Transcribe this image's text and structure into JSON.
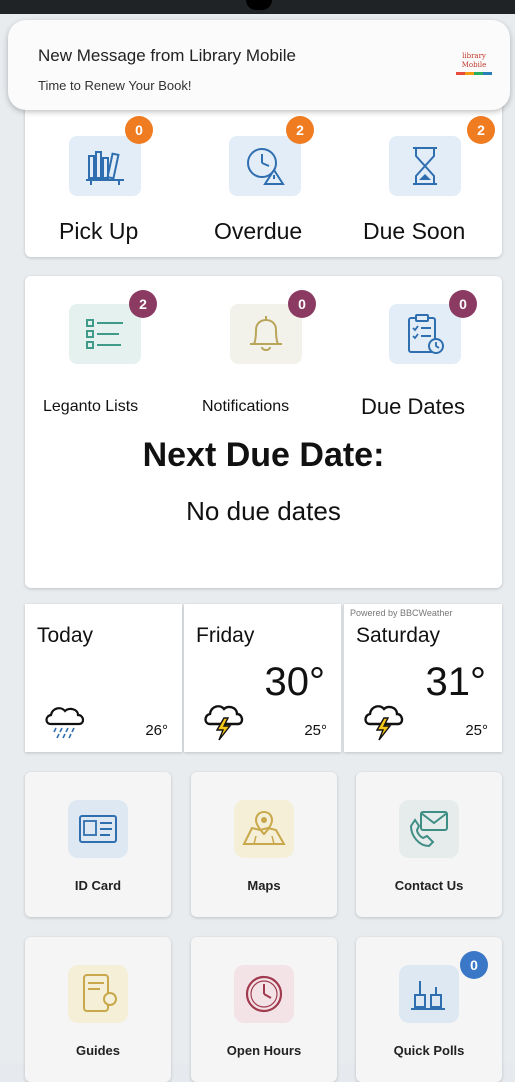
{
  "notification": {
    "title": "New Message from  Library Mobile",
    "body": "Time to Renew Your Book!",
    "logo_line1": "library",
    "logo_line2": "Mobile"
  },
  "loans": [
    {
      "label": "Pick Up",
      "count": "0",
      "icon": "books-on-shelf-icon"
    },
    {
      "label": "Overdue",
      "count": "2",
      "icon": "clock-warning-icon"
    },
    {
      "label": "Due Soon",
      "count": "2",
      "icon": "hourglass-icon"
    }
  ],
  "account": [
    {
      "label": "Leganto Lists",
      "count": "2",
      "icon": "list-icon"
    },
    {
      "label": "Notifications",
      "count": "0",
      "icon": "bell-icon"
    },
    {
      "label": "Due Dates",
      "count": "0",
      "icon": "checklist-clipboard-icon"
    }
  ],
  "next_due": {
    "heading": "Next Due Date:",
    "value": "No due dates"
  },
  "weather": {
    "powered_by": "Powered by BBCWeather",
    "days": [
      {
        "day": "Today",
        "high": "",
        "low": "26°",
        "icon": "rain-cloud-icon"
      },
      {
        "day": "Friday",
        "high": "30°",
        "low": "25°",
        "icon": "thunder-cloud-icon"
      },
      {
        "day": "Saturday",
        "high": "31°",
        "low": "25°",
        "icon": "thunder-cloud-icon"
      }
    ]
  },
  "tiles": [
    {
      "label": "ID Card",
      "icon": "id-card-icon"
    },
    {
      "label": "Maps",
      "icon": "map-icon"
    },
    {
      "label": "Contact Us",
      "icon": "phone-mail-icon"
    },
    {
      "label": "Guides",
      "icon": "guide-tablet-icon"
    },
    {
      "label": "Open Hours",
      "icon": "clock-icon"
    },
    {
      "label": "Quick Polls",
      "icon": "poll-icon",
      "count": "0"
    }
  ],
  "colors": {
    "badge_orange": "#f07c22",
    "badge_purple": "#8b3a62",
    "badge_blue": "#3a78c7",
    "background": "#e8ecef"
  }
}
